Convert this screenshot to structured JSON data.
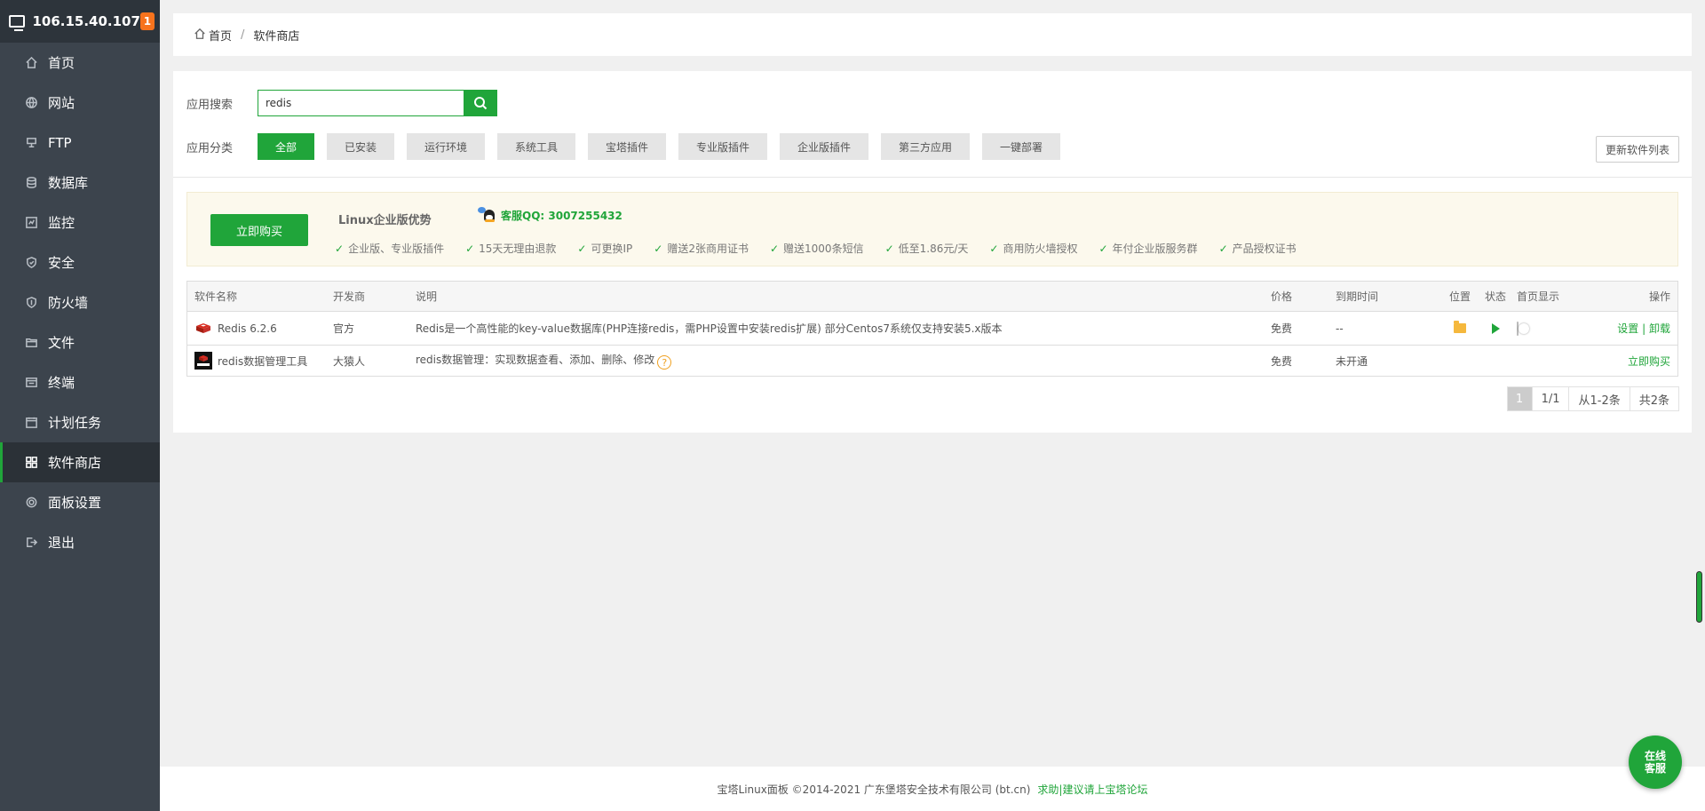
{
  "sidebar": {
    "server_ip": "106.15.40.107",
    "badge_count": "1",
    "items": [
      {
        "label": "首页",
        "icon": "home-icon"
      },
      {
        "label": "网站",
        "icon": "globe-icon"
      },
      {
        "label": "FTP",
        "icon": "ftp-icon"
      },
      {
        "label": "数据库",
        "icon": "database-icon"
      },
      {
        "label": "监控",
        "icon": "monitor-icon"
      },
      {
        "label": "安全",
        "icon": "shield-icon"
      },
      {
        "label": "防火墙",
        "icon": "firewall-icon"
      },
      {
        "label": "文件",
        "icon": "folder-icon"
      },
      {
        "label": "终端",
        "icon": "terminal-icon"
      },
      {
        "label": "计划任务",
        "icon": "calendar-icon"
      },
      {
        "label": "软件商店",
        "icon": "grid-icon"
      },
      {
        "label": "面板设置",
        "icon": "gear-icon"
      },
      {
        "label": "退出",
        "icon": "logout-icon"
      }
    ],
    "active_index": 10
  },
  "breadcrumb": {
    "home": "首页",
    "current": "软件商店"
  },
  "search": {
    "label": "应用搜索",
    "value": "redis"
  },
  "categories": {
    "label": "应用分类",
    "items": [
      "全部",
      "已安装",
      "运行环境",
      "系统工具",
      "宝塔插件",
      "专业版插件",
      "企业版插件",
      "第三方应用",
      "一键部署"
    ],
    "active": "全部"
  },
  "update_button": "更新软件列表",
  "promo": {
    "buy_label": "立即购买",
    "title": "Linux企业版优势",
    "qq": "客服QQ: 3007255432",
    "features": [
      "企业版、专业版插件",
      "15天无理由退款",
      "可更换IP",
      "赠送2张商用证书",
      "赠送1000条短信",
      "低至1.86元/天",
      "商用防火墙授权",
      "年付企业版服务群",
      "产品授权证书"
    ]
  },
  "table": {
    "headers": [
      "软件名称",
      "开发商",
      "说明",
      "价格",
      "到期时间",
      "位置",
      "状态",
      "首页显示",
      "操作"
    ],
    "rows": [
      {
        "name": "Redis 6.2.6",
        "developer": "官方",
        "desc": "Redis是一个高性能的key-value数据库(PHP连接redis，需PHP设置中安装redis扩展) 部分Centos7系统仅支持安装5.x版本",
        "price": "免费",
        "expire": "--",
        "action_settings": "设置",
        "action_sep": "|",
        "action_uninstall": "卸载"
      },
      {
        "name": "redis数据管理工具",
        "developer": "大猿人",
        "desc": "redis数据管理：实现数据查看、添加、删除、修改",
        "price": "免费",
        "expire": "未开通",
        "action_buy": "立即购买"
      }
    ]
  },
  "pager": {
    "current": "1",
    "pages": "1/1",
    "range": "从1-2条",
    "total": "共2条"
  },
  "footer": {
    "copyright": "宝塔Linux面板 ©2014-2021 广东堡塔安全技术有限公司 (bt.cn)",
    "link": "求助|建议请上宝塔论坛"
  },
  "chat": {
    "label": "在线客服"
  },
  "colors": {
    "accent": "#20a53a",
    "sidebar_bg": "#3c444d",
    "badge": "#f7731d"
  }
}
